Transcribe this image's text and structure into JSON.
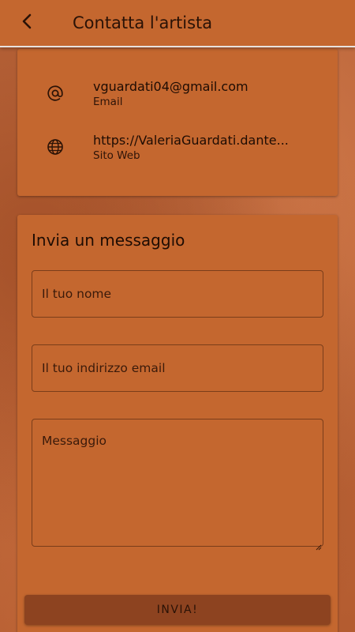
{
  "appbar": {
    "title": "Contatta l'artista",
    "back_icon": "chevron-left-icon"
  },
  "contact_info": [
    {
      "icon": "at-sign-icon",
      "value": "vguardati04@gmail.com",
      "label": "Email"
    },
    {
      "icon": "globe-icon",
      "value": "https://ValeriaGuardati.dante...",
      "label": "Sito Web"
    }
  ],
  "form": {
    "title": "Invia un messaggio",
    "name_placeholder": "Il tuo nome",
    "email_placeholder": "Il tuo indirizzo email",
    "message_placeholder": "Messaggio",
    "submit_label": "INVIA!"
  },
  "colors": {
    "primary": "#c4672f",
    "button": "#8d4320",
    "text": "#1e0c03"
  }
}
